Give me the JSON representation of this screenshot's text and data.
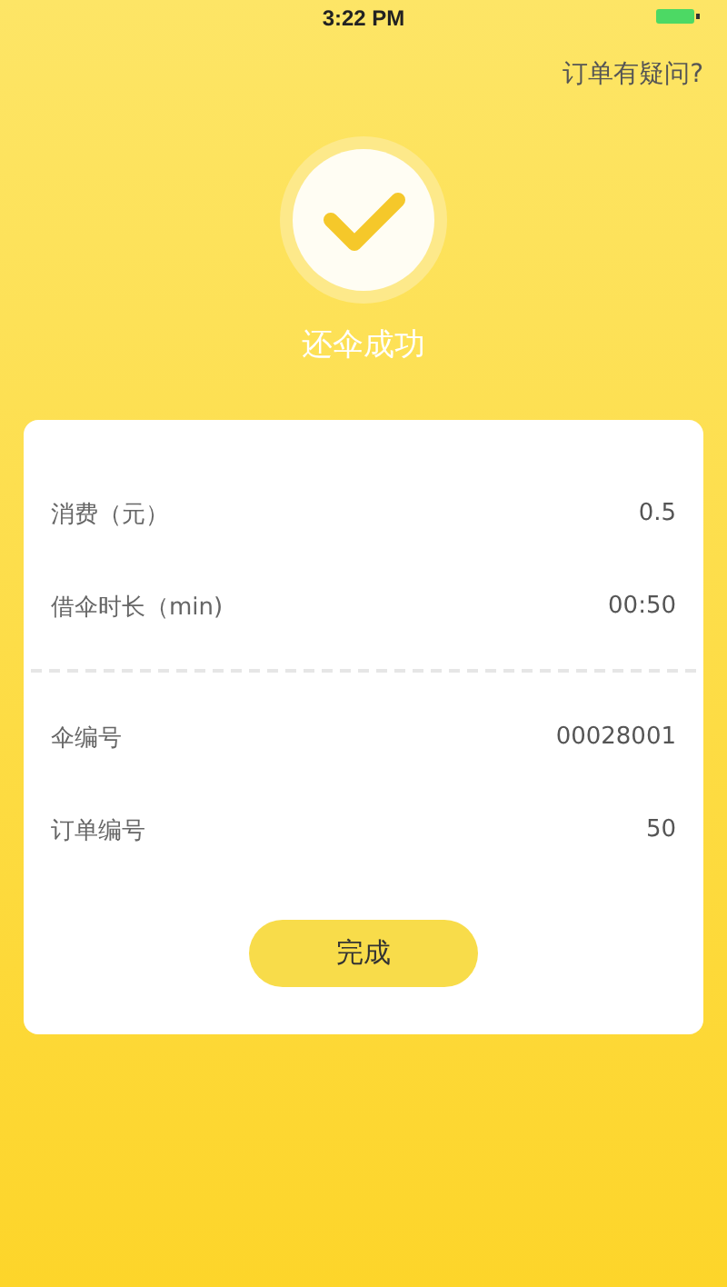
{
  "status_bar": {
    "time": "3:22 PM"
  },
  "help_link": "订单有疑问?",
  "result": {
    "title": "还伞成功"
  },
  "summary": [
    {
      "label": "消费（元）",
      "value": "0.5"
    },
    {
      "label": "借伞时长（min)",
      "value": "00:50"
    }
  ],
  "details": [
    {
      "label": "伞编号",
      "value": "00028001"
    },
    {
      "label": "订单编号",
      "value": "50"
    }
  ],
  "done_button": "完成"
}
